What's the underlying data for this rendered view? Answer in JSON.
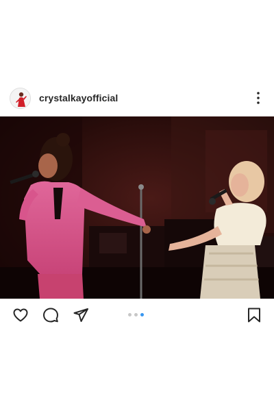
{
  "post": {
    "username": "crystalkayofficial",
    "carousel": {
      "total": 3,
      "current": 3
    }
  },
  "icons": {
    "more": "more-options-icon",
    "like": "heart-icon",
    "comment": "comment-icon",
    "share": "send-icon",
    "save": "bookmark-icon"
  },
  "colors": {
    "text": "#262626",
    "pager_active": "#3897f0",
    "pager_inactive": "#c7c7c7"
  }
}
